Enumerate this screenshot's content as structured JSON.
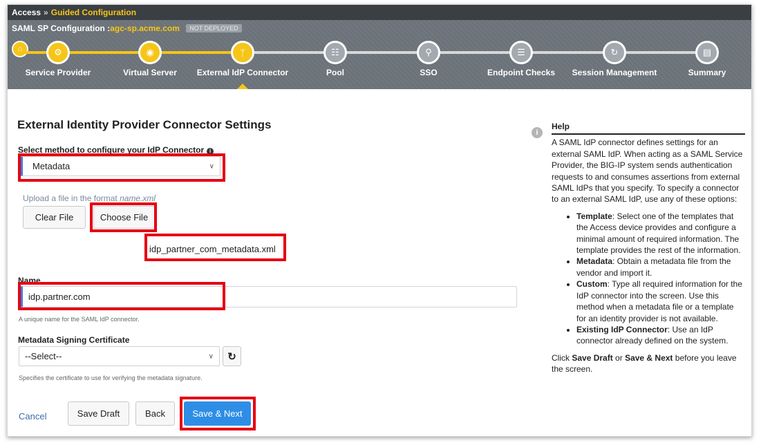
{
  "breadcrumb": {
    "root": "Access",
    "separator": "»",
    "current": "Guided Configuration"
  },
  "config": {
    "prefix": "SAML SP Configuration :",
    "host": "agc-sp.acme.com",
    "status": "NOT DEPLOYED"
  },
  "steps": [
    {
      "label": "Service Provider",
      "state": "done",
      "icon": "gears-icon"
    },
    {
      "label": "Virtual Server",
      "state": "done",
      "icon": "globe-icon"
    },
    {
      "label": "External IdP Connector",
      "state": "current",
      "icon": "fork-icon"
    },
    {
      "label": "Pool",
      "state": "todo",
      "icon": "sitemap-icon"
    },
    {
      "label": "SSO",
      "state": "todo",
      "icon": "key-icon"
    },
    {
      "label": "Endpoint Checks",
      "state": "todo",
      "icon": "list-icon"
    },
    {
      "label": "Session Management",
      "state": "todo",
      "icon": "history-icon"
    },
    {
      "label": "Summary",
      "state": "todo",
      "icon": "summary-icon"
    }
  ],
  "form": {
    "heading": "External Identity Provider Connector Settings",
    "method_label": "Select method to configure your IdP Connector",
    "method_value": "Metadata",
    "upload_hint_prefix": "Upload a file in the format ",
    "upload_hint_format": "name.xml",
    "clear_file": "Clear File",
    "choose_file": "Choose File",
    "file_name": "idp_partner_com_metadata.xml",
    "name_label": "Name",
    "name_value": "idp.partner.com",
    "name_note": "A unique name for the SAML IdP connector.",
    "cert_label": "Metadata Signing Certificate",
    "cert_value": "--Select--",
    "cert_note": "Specifies the certificate to use for verifying the metadata signature."
  },
  "actions": {
    "cancel": "Cancel",
    "save_draft": "Save Draft",
    "back": "Back",
    "save_next": "Save & Next"
  },
  "help": {
    "title": "Help",
    "intro": "A SAML IdP connector defines settings for an external SAML IdP. When acting as a SAML Service Provider, the BIG-IP system sends authentication requests to and consumes assertions from external SAML IdPs that you specify. To specify a connector to an external SAML IdP, use any of these options:",
    "items": [
      {
        "term": "Template",
        "text": ": Select one of the templates that the Access device provides and configure a minimal amount of required information. The template provides the rest of the information."
      },
      {
        "term": "Metadata",
        "text": ": Obtain a metadata file from the vendor and import it."
      },
      {
        "term": "Custom",
        "text": ": Type all required information for the IdP connector into the screen. Use this method when a metadata file or a template for an identity provider is not available."
      },
      {
        "term": "Existing IdP Connector",
        "text": ": Use an IdP connector already defined on the system."
      }
    ],
    "outro_1": "Click ",
    "outro_save_draft": "Save Draft",
    "outro_2": " or ",
    "outro_save_next": "Save & Next",
    "outro_3": " before you leave the screen."
  },
  "colors": {
    "accent_yellow": "#f5c518",
    "highlight_red": "#e60012",
    "primary_blue": "#2e8ee6"
  }
}
